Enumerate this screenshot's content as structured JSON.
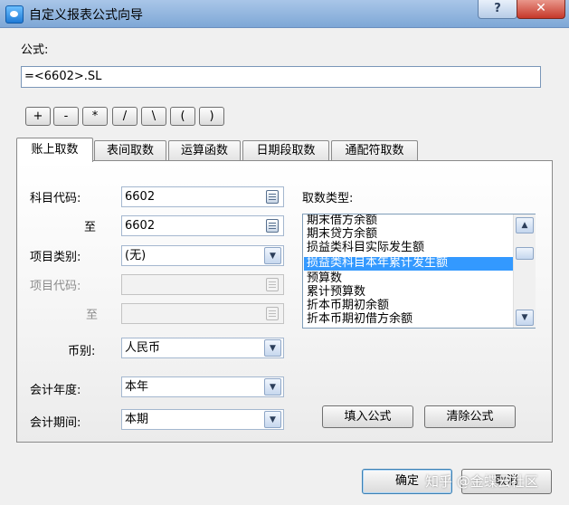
{
  "window": {
    "title": "自定义报表公式向导",
    "help": "?",
    "close": "✕"
  },
  "formula": {
    "label": "公式:",
    "value": "=<6602>.SL"
  },
  "operators": [
    "+",
    "-",
    "*",
    "/",
    "\\",
    "(",
    ")"
  ],
  "tabs": [
    "账上取数",
    "表间取数",
    "运算函数",
    "日期段取数",
    "通配符取数"
  ],
  "fields": {
    "account_code": {
      "label": "科目代码:",
      "value": "6602"
    },
    "to1": {
      "label": "至",
      "value": "6602"
    },
    "item_category": {
      "label": "项目类别:",
      "value": "(无)"
    },
    "item_code": {
      "label": "项目代码:",
      "value": ""
    },
    "to2": {
      "label": "至",
      "value": ""
    },
    "currency": {
      "label": "币别:",
      "value": "人民币"
    },
    "fiscal_year": {
      "label": "会计年度:",
      "value": "本年"
    },
    "fiscal_period": {
      "label": "会计期间:",
      "value": "本期"
    }
  },
  "fetch_type": {
    "label": "取数类型:",
    "items": [
      "期末借方余额",
      "期末贷方余额",
      "损益类科目实际发生额",
      "损益类科目本年累计发生额",
      "预算数",
      "累计预算数",
      "折本币期初余额",
      "折本币期初借方余额"
    ],
    "selected_index": 3
  },
  "buttons": {
    "fill": "填入公式",
    "clear": "清除公式",
    "ok": "确定",
    "cancel": "取消"
  },
  "watermark": "知乎 @金蝶云社区"
}
